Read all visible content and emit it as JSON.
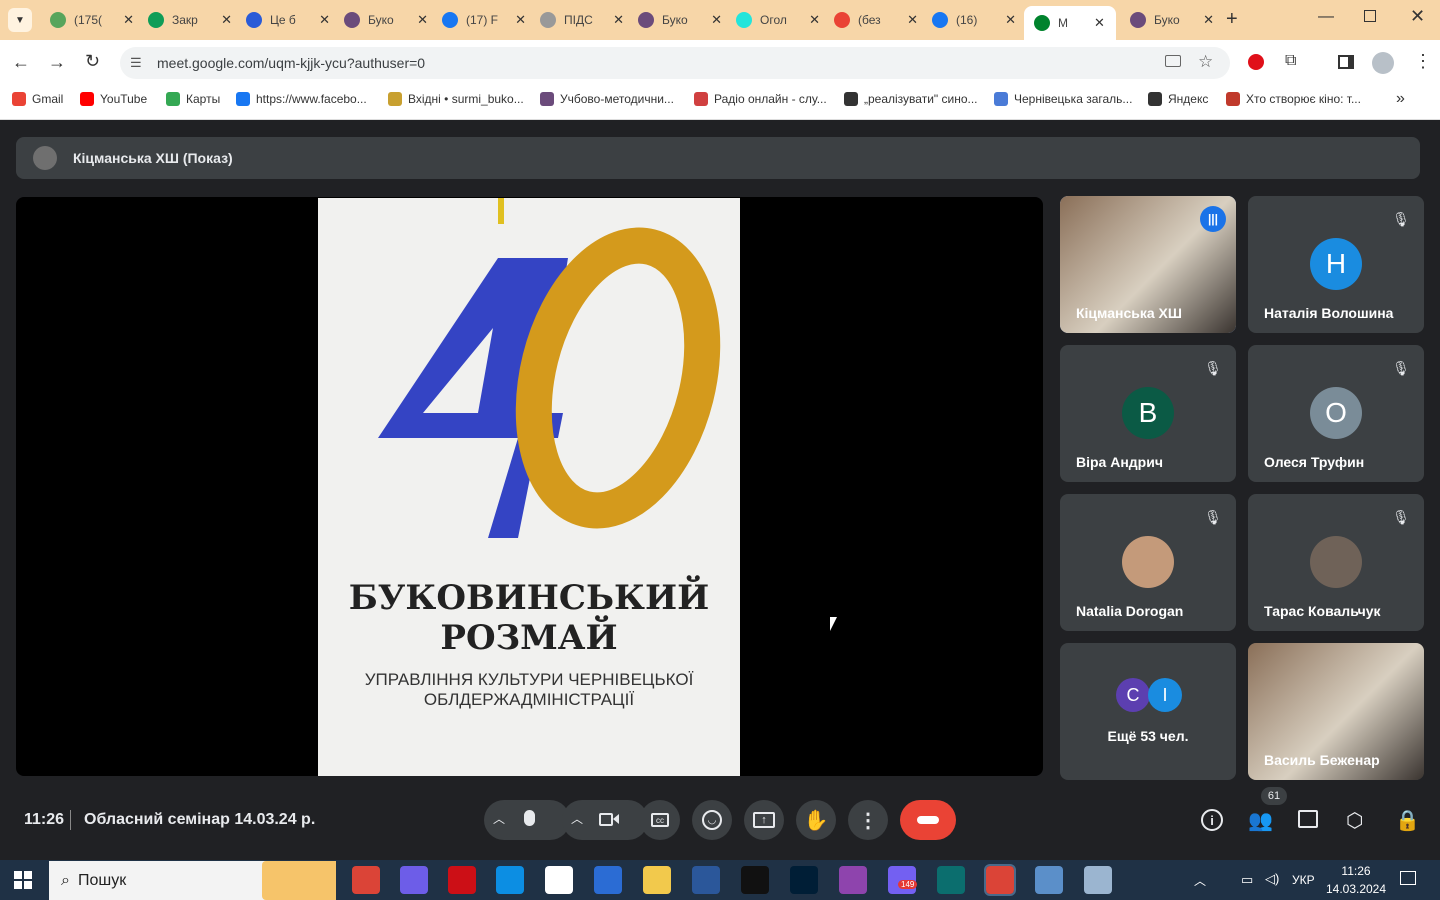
{
  "browser": {
    "tabs": [
      {
        "title": "(175(",
        "favicon": "gmail-icon",
        "color": "#58a55c"
      },
      {
        "title": "Закр",
        "favicon": "sheets-icon",
        "color": "#0f9d58"
      },
      {
        "title": "Це б",
        "favicon": "k-icon",
        "color": "#2a5bd7"
      },
      {
        "title": "Буко",
        "favicon": "gear-icon",
        "color": "#6b4b7b"
      },
      {
        "title": "(17) F",
        "favicon": "facebook-icon",
        "color": "#1877f2"
      },
      {
        "title": "ПІДС",
        "favicon": "spiral-icon",
        "color": "#999999"
      },
      {
        "title": "Буко",
        "favicon": "gear-icon",
        "color": "#6b4b7b"
      },
      {
        "title": "Огол",
        "favicon": "olx-icon",
        "color": "#23e5db"
      },
      {
        "title": "(без",
        "favicon": "gmail-icon",
        "color": "#ea4335"
      },
      {
        "title": "(16) ",
        "favicon": "facebook-icon",
        "color": "#1877f2"
      },
      {
        "title": "M",
        "favicon": "meet-icon",
        "color": "#00832d",
        "active": true
      },
      {
        "title": "Буко",
        "favicon": "gear-icon",
        "color": "#6b4b7b"
      }
    ],
    "url": "meet.google.com/uqm-kjjk-ycu?authuser=0",
    "bookmarks": [
      {
        "label": "Gmail",
        "icon": "gmail-icon",
        "color": "#ea4335"
      },
      {
        "label": "YouTube",
        "icon": "youtube-icon",
        "color": "#ff0000"
      },
      {
        "label": "Карты",
        "icon": "maps-icon",
        "color": "#34a853"
      },
      {
        "label": "https://www.facebo...",
        "icon": "facebook-icon",
        "color": "#1877f2"
      },
      {
        "label": "Вхідні • surmi_buko...",
        "icon": "mail-icon",
        "color": "#c8a030"
      },
      {
        "label": "Учбово-методични...",
        "icon": "gear-icon",
        "color": "#6b4b7b"
      },
      {
        "label": "Радіо онлайн - слу...",
        "icon": "radio-icon",
        "color": "#d04040"
      },
      {
        "label": "„реалізувати\" сино...",
        "icon": "globe-icon",
        "color": "#333333"
      },
      {
        "label": "Чернівецька загаль...",
        "icon": "pin-icon",
        "color": "#4a7bd7"
      },
      {
        "label": "Яндекс",
        "icon": "globe-icon",
        "color": "#333333"
      },
      {
        "label": "Хто створює кіно: т...",
        "icon": "film-icon",
        "color": "#c0392b"
      }
    ]
  },
  "meet": {
    "presenter_label": "Кіцманська ХШ (Показ)",
    "poster": {
      "number": "40",
      "title_line1": "БУКОВИНСЬКИЙ",
      "title_line2": "РОЗМАЙ",
      "subtitle_line1": "УПРАВЛІННЯ КУЛЬТУРИ ЧЕРНІВЕЦЬКОЇ",
      "subtitle_line2": "ОБЛДЕРЖАДМІНІСТРАЦІЇ"
    },
    "participants": [
      {
        "name": "Кіцманська ХШ",
        "type": "video",
        "speaking": true
      },
      {
        "name": "Наталія Волошина",
        "initial": "H",
        "color": "#1a8ce0",
        "muted": true
      },
      {
        "name": "Віра Андрич",
        "initial": "B",
        "color": "#0b5a45",
        "muted": true
      },
      {
        "name": "Олеся Труфин",
        "initial": "О",
        "color": "#7a8c98",
        "muted": true
      },
      {
        "name": "Natalia Dorogan",
        "type": "photo",
        "muted": true
      },
      {
        "name": "Тарас Ковальчук",
        "type": "photo",
        "muted": true
      },
      {
        "name": "Ещё 53 чел.",
        "type": "more",
        "initials": [
          "C",
          "I"
        ]
      },
      {
        "name": "Василь Беженар",
        "type": "video"
      }
    ],
    "time": "11:26",
    "meeting_title": "Обласний семінар 14.03.24 р.",
    "participant_count": "61"
  },
  "taskbar": {
    "search_placeholder": "Пошук",
    "lang": "УКР",
    "time": "11:26",
    "date": "14.03.2024",
    "viber_badge": "149"
  }
}
